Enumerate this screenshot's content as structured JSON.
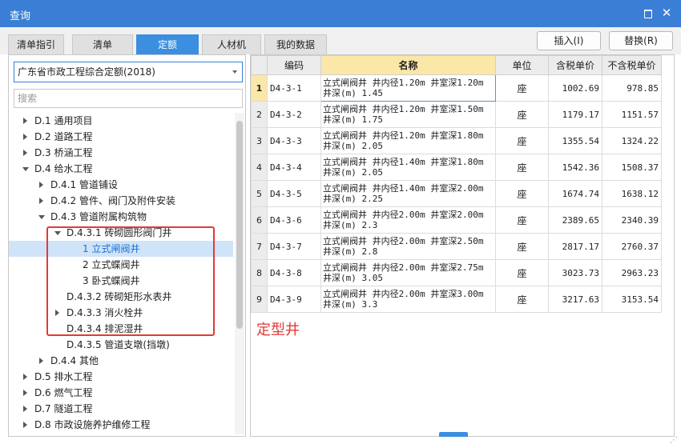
{
  "window": {
    "title": "查询"
  },
  "tabs": [
    {
      "label": "清单指引"
    },
    {
      "label": "清单"
    },
    {
      "label": "定额"
    },
    {
      "label": "人材机"
    },
    {
      "label": "我的数据"
    }
  ],
  "buttons": {
    "insert": "插入(I)",
    "replace": "替换(R)"
  },
  "left": {
    "selected_quota": "广东省市政工程综合定额(2018)",
    "search_placeholder": "搜索"
  },
  "tree": [
    {
      "label": "D.1 通用项目",
      "level": 0,
      "state": "closed"
    },
    {
      "label": "D.2 道路工程",
      "level": 0,
      "state": "closed"
    },
    {
      "label": "D.3 桥涵工程",
      "level": 0,
      "state": "closed"
    },
    {
      "label": "D.4 给水工程",
      "level": 0,
      "state": "open"
    },
    {
      "label": "D.4.1 管道铺设",
      "level": 1,
      "state": "closed"
    },
    {
      "label": "D.4.2 管件、阀门及附件安装",
      "level": 1,
      "state": "closed"
    },
    {
      "label": "D.4.3 管道附属构筑物",
      "level": 1,
      "state": "open"
    },
    {
      "label": "D.4.3.1 砖砌圆形阀门井",
      "level": 2,
      "state": "open"
    },
    {
      "label": "1 立式闸阀井",
      "level": 3,
      "state": "leaf",
      "selected": true
    },
    {
      "label": "2 立式蝶阀井",
      "level": 3,
      "state": "leaf"
    },
    {
      "label": "3 卧式蝶阀井",
      "level": 3,
      "state": "leaf"
    },
    {
      "label": "D.4.3.2 砖砌矩形水表井",
      "level": 2,
      "state": "leaf"
    },
    {
      "label": "D.4.3.3 消火栓井",
      "level": 2,
      "state": "closed"
    },
    {
      "label": "D.4.3.4 排泥湿井",
      "level": 2,
      "state": "leaf"
    },
    {
      "label": "D.4.3.5 管道支墩(挡墩)",
      "level": 2,
      "state": "leaf"
    },
    {
      "label": "D.4.4 其他",
      "level": 1,
      "state": "closed"
    },
    {
      "label": "D.5 排水工程",
      "level": 0,
      "state": "closed"
    },
    {
      "label": "D.6 燃气工程",
      "level": 0,
      "state": "closed"
    },
    {
      "label": "D.7 隧道工程",
      "level": 0,
      "state": "closed"
    },
    {
      "label": "D.8 市政设施养护维修工程",
      "level": 0,
      "state": "closed"
    }
  ],
  "table": {
    "headers": [
      "编码",
      "名称",
      "单位",
      "含税单价",
      "不含税单价"
    ],
    "rows": [
      {
        "no": "1",
        "code": "D4-3-1",
        "name": "立式闸阀井 井内径1.20m 井室深1.20m 井深(m) 1.45",
        "unit": "座",
        "tax_price": "1002.69",
        "notax_price": "978.85",
        "selected": true
      },
      {
        "no": "2",
        "code": "D4-3-2",
        "name": "立式闸阀井 井内径1.20m 井室深1.50m 井深(m) 1.75",
        "unit": "座",
        "tax_price": "1179.17",
        "notax_price": "1151.57"
      },
      {
        "no": "3",
        "code": "D4-3-3",
        "name": "立式闸阀井 井内径1.20m 井室深1.80m 井深(m) 2.05",
        "unit": "座",
        "tax_price": "1355.54",
        "notax_price": "1324.22"
      },
      {
        "no": "4",
        "code": "D4-3-4",
        "name": "立式闸阀井 井内径1.40m 井室深1.80m 井深(m) 2.05",
        "unit": "座",
        "tax_price": "1542.36",
        "notax_price": "1508.37"
      },
      {
        "no": "5",
        "code": "D4-3-5",
        "name": "立式闸阀井 井内径1.40m 井室深2.00m 井深(m) 2.25",
        "unit": "座",
        "tax_price": "1674.74",
        "notax_price": "1638.12"
      },
      {
        "no": "6",
        "code": "D4-3-6",
        "name": "立式闸阀井 井内径2.00m 井室深2.00m 井深(m) 2.3",
        "unit": "座",
        "tax_price": "2389.65",
        "notax_price": "2340.39"
      },
      {
        "no": "7",
        "code": "D4-3-7",
        "name": "立式闸阀井 井内径2.00m 井室深2.50m 井深(m) 2.8",
        "unit": "座",
        "tax_price": "2817.17",
        "notax_price": "2760.37"
      },
      {
        "no": "8",
        "code": "D4-3-8",
        "name": "立式闸阀井 井内径2.00m 井室深2.75m 井深(m) 3.05",
        "unit": "座",
        "tax_price": "3023.73",
        "notax_price": "2963.23"
      },
      {
        "no": "9",
        "code": "D4-3-9",
        "name": "立式闸阀井 井内径2.00m 井室深3.00m 井深(m) 3.3",
        "unit": "座",
        "tax_price": "3217.63",
        "notax_price": "3153.54"
      }
    ]
  },
  "annotation": "定型井",
  "colors": {
    "titlebar": "#3a7fd5",
    "active_tab": "#3a8fe0",
    "highlight": "#e53935",
    "name_header": "#fbe7a8"
  }
}
